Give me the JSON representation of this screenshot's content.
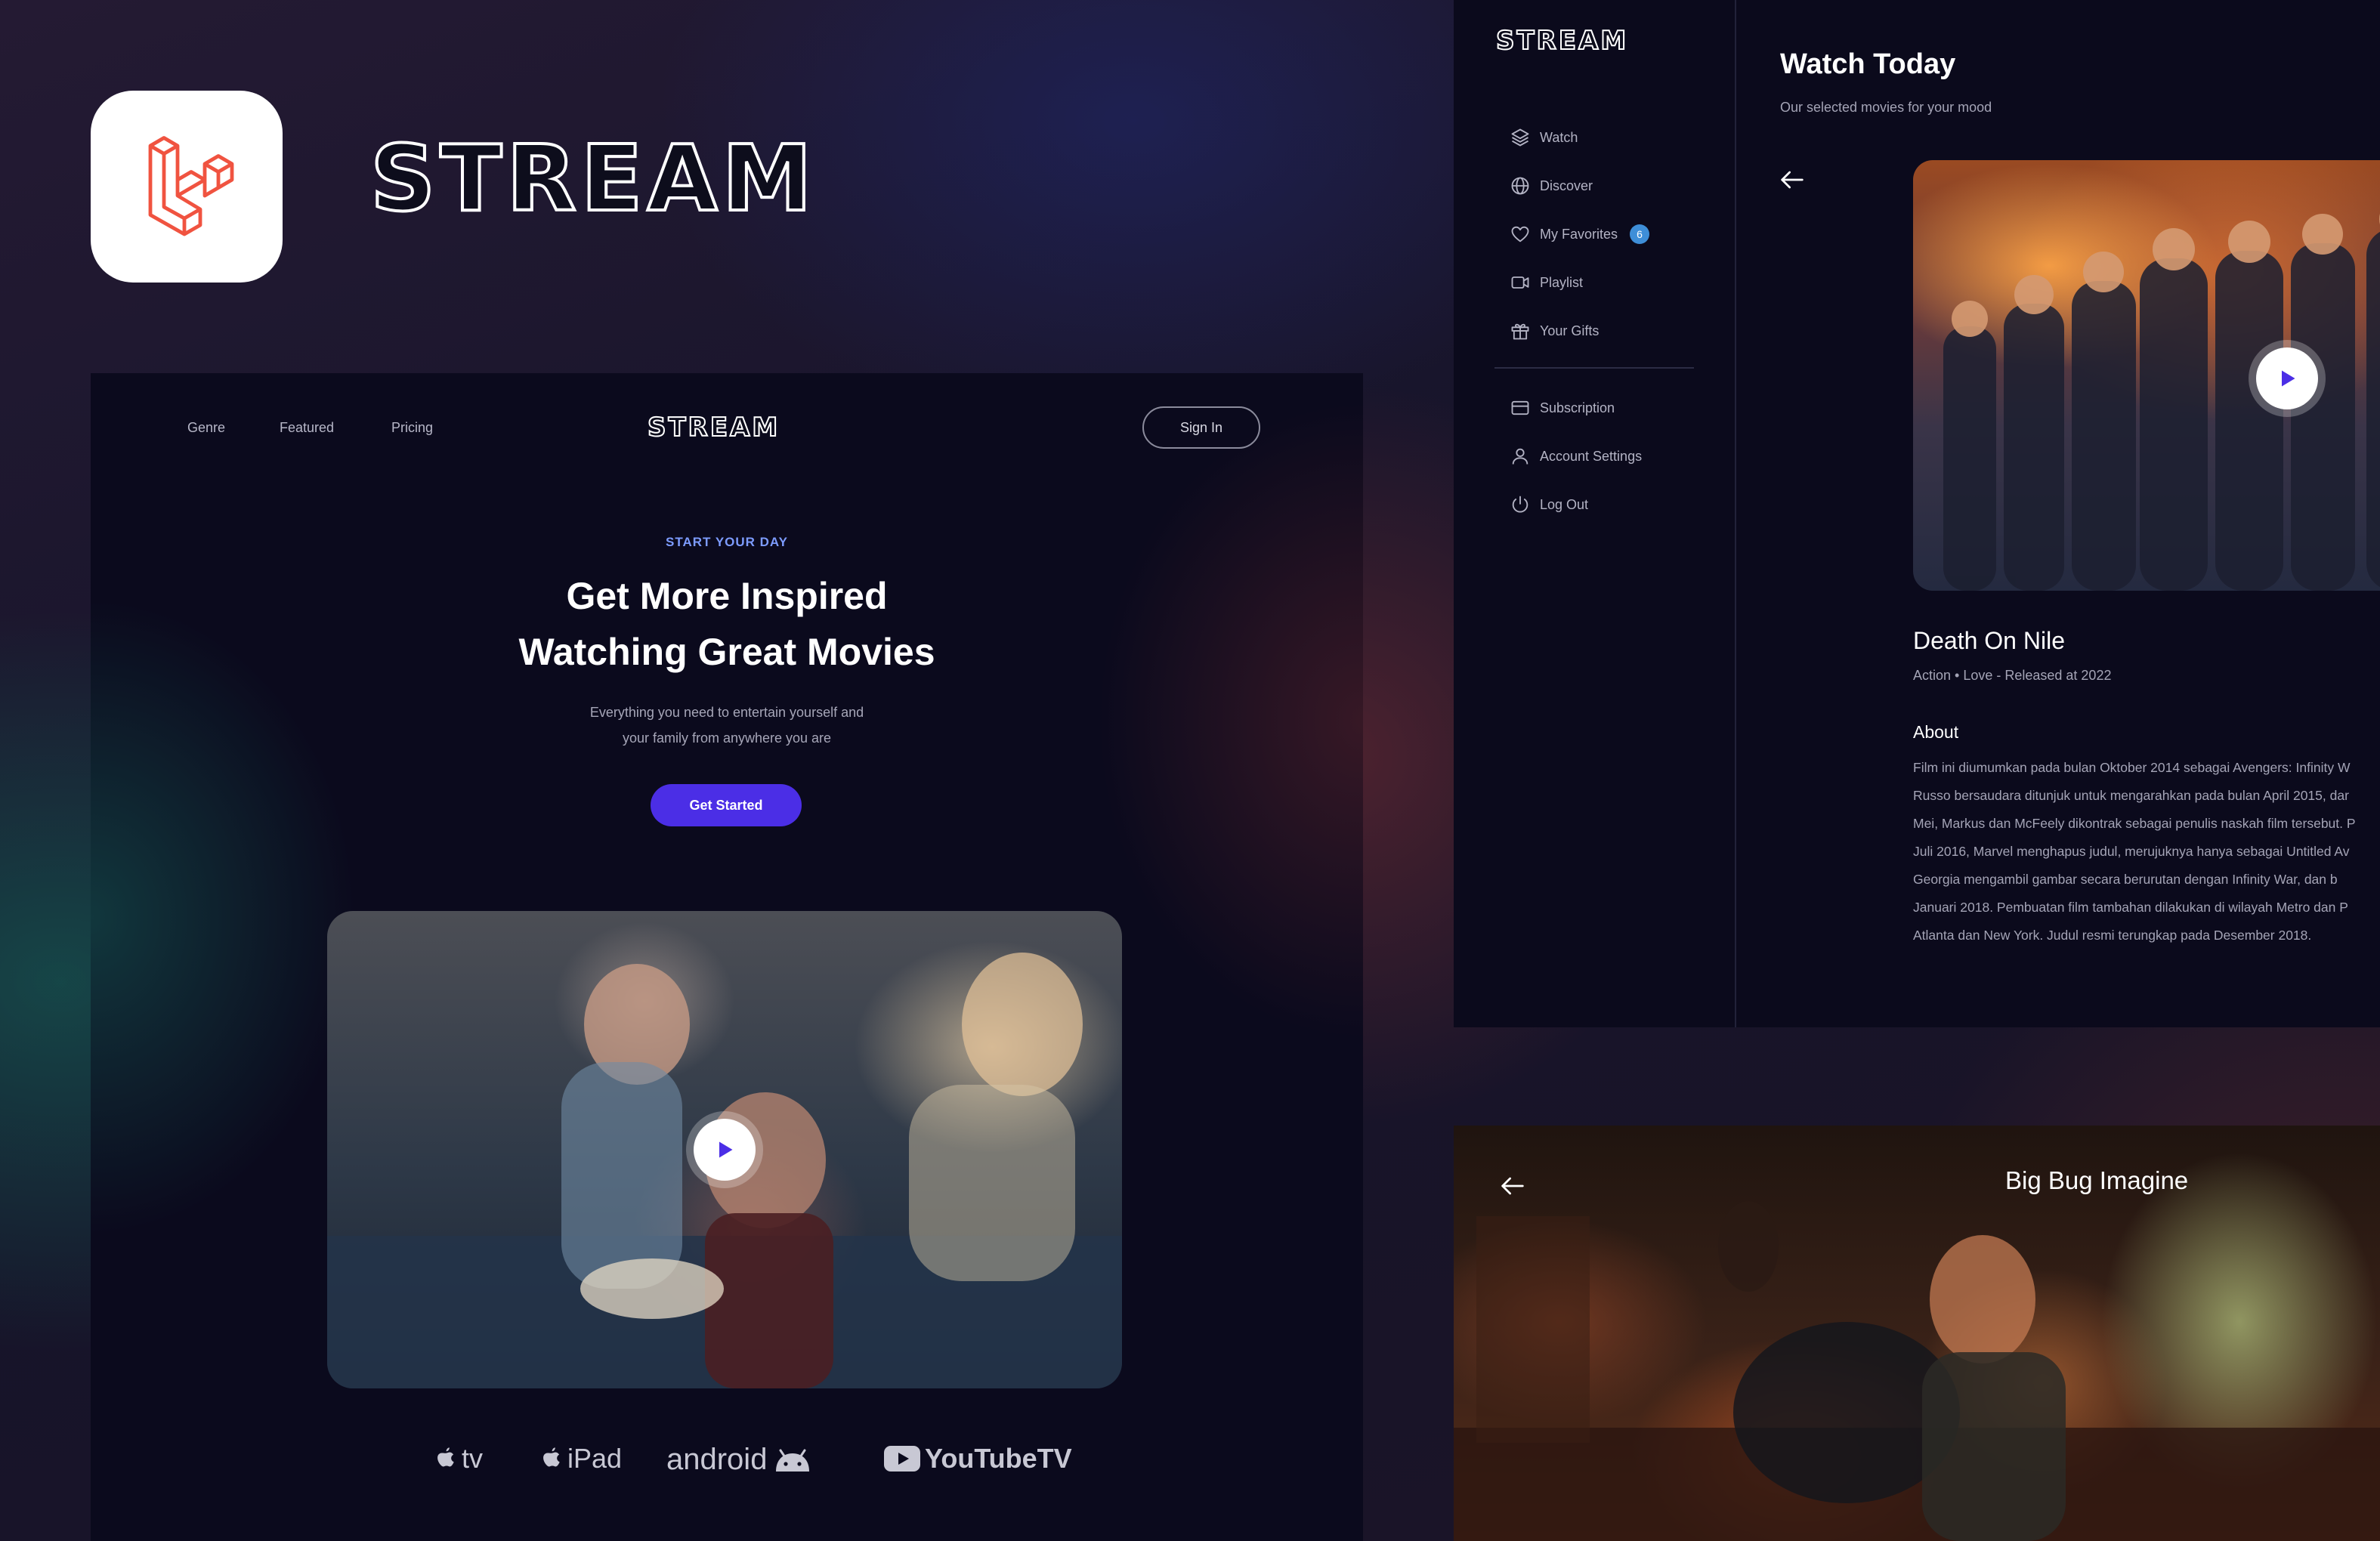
{
  "branding": {
    "app_name": "STREAM",
    "colors": {
      "laravel_red": "#f05340",
      "accent": "#4b2ee6",
      "badge": "#3e8ed8"
    }
  },
  "landing": {
    "nav": {
      "genre": "Genre",
      "featured": "Featured",
      "pricing": "Pricing",
      "logo": "STREAM",
      "sign_in": "Sign In"
    },
    "eyebrow": "START YOUR DAY",
    "title": "Get More Inspired\nWatching Great Movies",
    "subtitle": "Everything you need to entertain yourself and\nyour family from anywhere you are",
    "cta": "Get Started",
    "platforms": {
      "apple_tv": "tv",
      "ipad": "iPad",
      "android": "android",
      "youtube": "YouTubeTV"
    }
  },
  "dashboard": {
    "logo": "STREAM",
    "sidebar": {
      "watch": "Watch",
      "discover": "Discover",
      "favorites": "My Favorites",
      "favorites_count": "6",
      "playlist": "Playlist",
      "gifts": "Your Gifts",
      "subscription": "Subscription",
      "account": "Account Settings",
      "logout": "Log Out"
    },
    "main": {
      "title": "Watch Today",
      "subtitle": "Our selected movies for your mood",
      "movie_title": "Death On Nile",
      "movie_meta": "Action • Love - Released at 2022",
      "about_title": "About",
      "about_text": "Film ini diumumkan pada bulan Oktober 2014 sebagai Avengers: Infinity W\nRusso bersaudara ditunjuk untuk mengarahkan pada bulan April 2015, dar\nMei, Markus dan McFeely dikontrak sebagai penulis naskah film tersebut. P\nJuli 2016, Marvel menghapus judul, merujuknya hanya sebagai Untitled Av\nGeorgia mengambil gambar secara berurutan dengan Infinity War, dan b\nJanuari 2018. Pembuatan film tambahan dilakukan di wilayah Metro dan P\nAtlanta dan New York. Judul resmi terungkap pada Desember 2018."
    }
  },
  "player": {
    "title": "Big Bug Imagine"
  }
}
